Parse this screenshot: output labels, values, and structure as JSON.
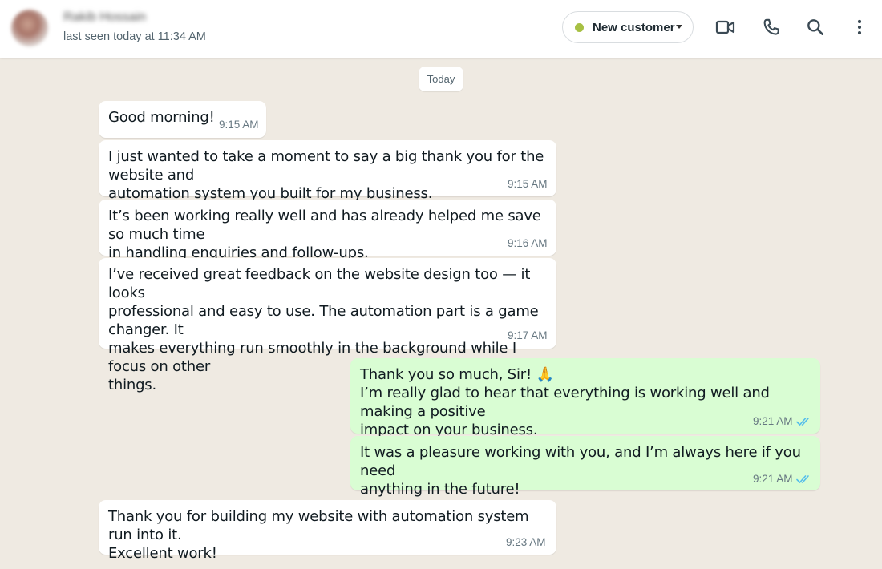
{
  "header": {
    "contact_name": "Rakib Hossain",
    "last_seen": "last seen today at 11:34 AM",
    "label": {
      "text": "New customer",
      "color": "#a7c043"
    },
    "icons": [
      "video-call-icon",
      "voice-call-icon",
      "search-icon",
      "menu-icon"
    ]
  },
  "chat": {
    "date_divider": "Today",
    "messages": [
      {
        "direction": "incoming",
        "lines": [
          "Good morning!"
        ],
        "time": "9:15 AM"
      },
      {
        "direction": "incoming",
        "lines": [
          "I just wanted to take a moment to say a big thank you for the website and",
          "automation system you built for my business."
        ],
        "time": "9:15 AM"
      },
      {
        "direction": "incoming",
        "lines": [
          "It’s been working really well and has already helped me save so much time",
          "in handling enquiries and follow-ups."
        ],
        "time": "9:16 AM"
      },
      {
        "direction": "incoming",
        "lines": [
          "I’ve received great feedback on the website design too — it looks",
          "professional and easy to use. The automation part is a game changer. It",
          "makes everything run smoothly in the background while I focus on other",
          "things."
        ],
        "time": "9:17 AM"
      },
      {
        "direction": "outgoing",
        "lines": [
          "Thank you so much, Sir! 🙏",
          "I’m really glad to hear that everything is working well and making a positive",
          "impact on your business."
        ],
        "time": "9:21 AM",
        "status": "read"
      },
      {
        "direction": "outgoing",
        "lines": [
          "It was a pleasure working with you, and I’m always here if you need",
          "anything in the future!"
        ],
        "time": "9:21 AM",
        "status": "read"
      },
      {
        "direction": "incoming",
        "lines": [
          "Thank you for building my website with automation system run into it.",
          "Excellent work!"
        ],
        "time": "9:23 AM"
      }
    ]
  },
  "colors": {
    "background": "#efeae2",
    "incoming_bubble": "#ffffff",
    "outgoing_bubble": "#d9fdd3",
    "read_ticks": "#53bdeb"
  }
}
